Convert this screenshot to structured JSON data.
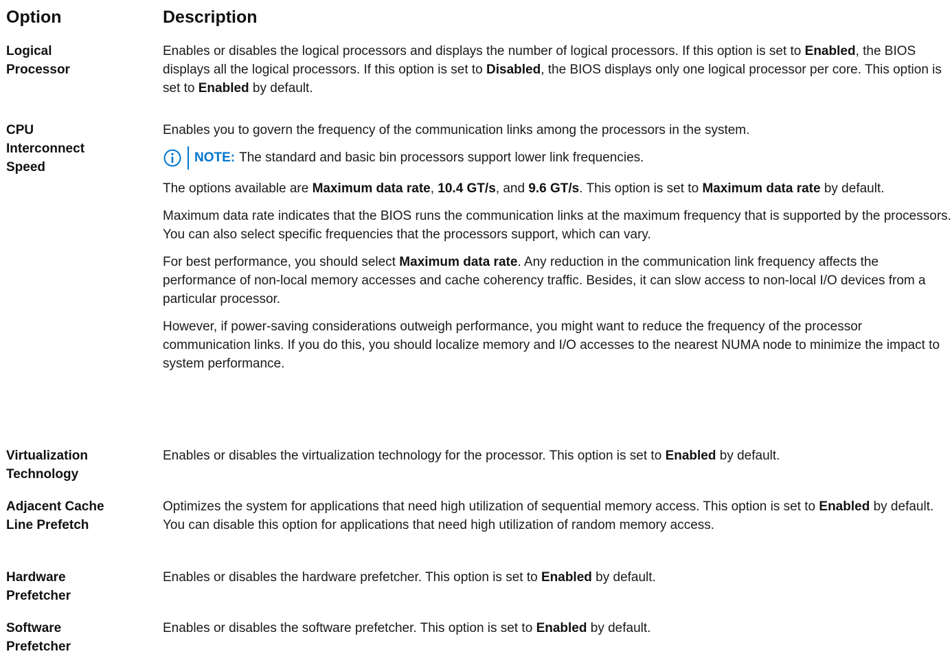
{
  "header": {
    "option": "Option",
    "description": "Description"
  },
  "rows": [
    {
      "option": "Logical\nProcessor",
      "paragraphs": [
        [
          {
            "t": "Enables or disables the logical processors and displays the number of logical processors. If this option is set to "
          },
          {
            "t": "Enabled",
            "b": true
          },
          {
            "t": ", the BIOS displays all the logical processors. If this option is set to "
          },
          {
            "t": "Disabled",
            "b": true
          },
          {
            "t": ", the BIOS displays only one logical processor per core. This option is set to "
          },
          {
            "t": "Enabled",
            "b": true
          },
          {
            "t": " by default."
          }
        ]
      ]
    },
    {
      "option": "CPU\nInterconnect\nSpeed",
      "paragraphs": [
        [
          {
            "t": "Enables you to govern the frequency of the communication links among the processors in the system."
          }
        ],
        {
          "note": {
            "label": "NOTE:",
            "text": "The standard and basic bin processors support lower link frequencies."
          }
        },
        [
          {
            "t": "The options available are "
          },
          {
            "t": "Maximum data rate",
            "b": true
          },
          {
            "t": ", "
          },
          {
            "t": "10.4 GT/s",
            "b": true
          },
          {
            "t": ", and "
          },
          {
            "t": "9.6 GT/s",
            "b": true
          },
          {
            "t": ". This option is set to "
          },
          {
            "t": "Maximum data rate",
            "b": true
          },
          {
            "t": " by default."
          }
        ],
        [
          {
            "t": "Maximum data rate indicates that the BIOS runs the communication links at the maximum frequency that is supported by the processors. You can also select specific frequencies that the processors support, which can vary."
          }
        ],
        [
          {
            "t": "For best performance, you should select "
          },
          {
            "t": "Maximum data rate",
            "b": true
          },
          {
            "t": ". Any reduction in the communication link frequency affects the performance of non-local memory accesses and cache coherency traffic. Besides, it can slow access to non-local I/O devices from a particular processor."
          }
        ],
        [
          {
            "t": "However, if power-saving considerations outweigh performance, you might want to reduce the frequency of the processor communication links. If you do this, you should localize memory and I/O accesses to the nearest NUMA node to minimize the impact to system performance."
          }
        ]
      ]
    },
    {
      "option": "Virtualization\nTechnology",
      "paragraphs": [
        [
          {
            "t": "Enables or disables the virtualization technology for the processor. This option is set to "
          },
          {
            "t": "Enabled",
            "b": true
          },
          {
            "t": " by default."
          }
        ]
      ]
    },
    {
      "option": "Adjacent Cache\nLine Prefetch",
      "paragraphs": [
        [
          {
            "t": "Optimizes the system for applications that need high utilization of sequential memory access. This option is set to "
          },
          {
            "t": "Enabled",
            "b": true
          },
          {
            "t": " by default. You can disable this option for applications that need high utilization of random memory access."
          }
        ]
      ]
    },
    {
      "option": "Hardware\nPrefetcher",
      "paragraphs": [
        [
          {
            "t": "Enables or disables the hardware prefetcher. This option is set to "
          },
          {
            "t": "Enabled",
            "b": true
          },
          {
            "t": " by default."
          }
        ]
      ]
    },
    {
      "option": "Software\nPrefetcher",
      "paragraphs": [
        [
          {
            "t": "Enables or disables the software prefetcher. This option is set to "
          },
          {
            "t": "Enabled",
            "b": true
          },
          {
            "t": " by default."
          }
        ]
      ]
    }
  ],
  "colors": {
    "note_accent": "#0076ce",
    "text": "#1a1a1a"
  },
  "icons": {
    "note": "info-circle-icon"
  }
}
